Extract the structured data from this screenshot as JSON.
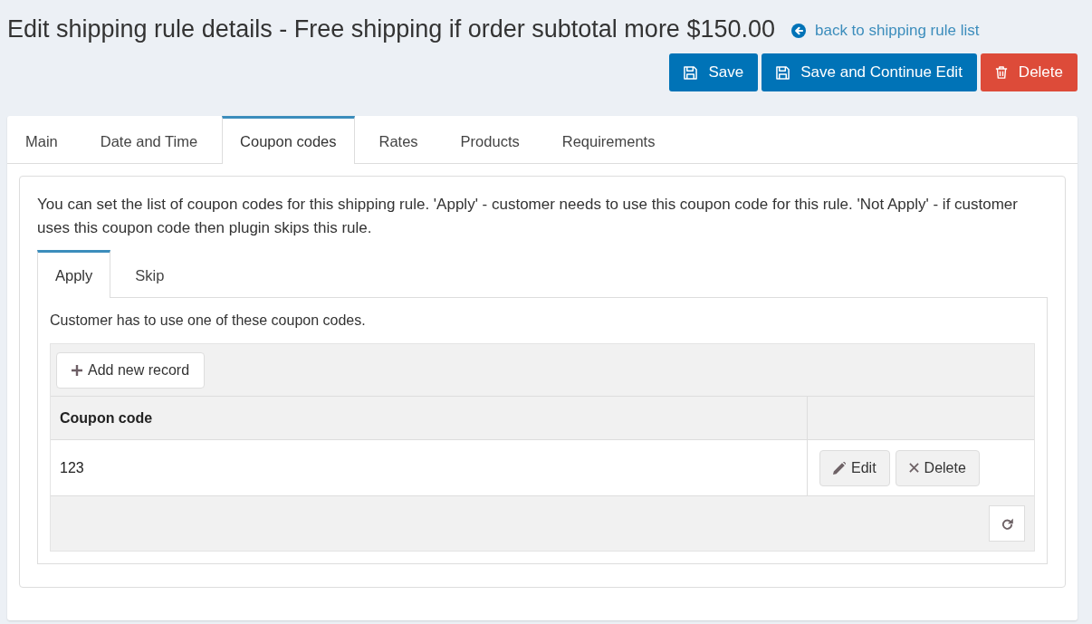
{
  "page": {
    "title": "Edit shipping rule details - Free shipping if order subtotal more $150.00",
    "back_link": "back to shipping rule list"
  },
  "actions": [
    {
      "label": "Save",
      "kind": "save"
    },
    {
      "label": "Save and Continue Edit",
      "kind": "save"
    },
    {
      "label": "Delete",
      "kind": "delete"
    }
  ],
  "tabs": [
    {
      "label": "Main",
      "selected": false
    },
    {
      "label": "Date and Time",
      "selected": false
    },
    {
      "label": "Coupon codes",
      "selected": true
    },
    {
      "label": "Rates",
      "selected": false
    },
    {
      "label": "Products",
      "selected": false
    },
    {
      "label": "Requirements",
      "selected": false
    }
  ],
  "coupon_codes": {
    "description": "You can set the list of coupon codes for this shipping rule. 'Apply' - customer needs to use this coupon code for this rule. 'Not Apply' - if customer uses this coupon code then plugin skips this rule.",
    "subtabs": [
      {
        "label": "Apply",
        "selected": true
      },
      {
        "label": "Skip",
        "selected": false
      }
    ],
    "hint": "Customer has to use one of these coupon codes.",
    "grid": {
      "toolbar_button": "Add new record",
      "columns": [
        "Coupon code"
      ],
      "rows": [
        {
          "cells": [
            "123"
          ],
          "actions": [
            {
              "label": "Edit",
              "kind": "edit"
            },
            {
              "label": "Delete",
              "kind": "delete"
            }
          ]
        }
      ]
    }
  }
}
